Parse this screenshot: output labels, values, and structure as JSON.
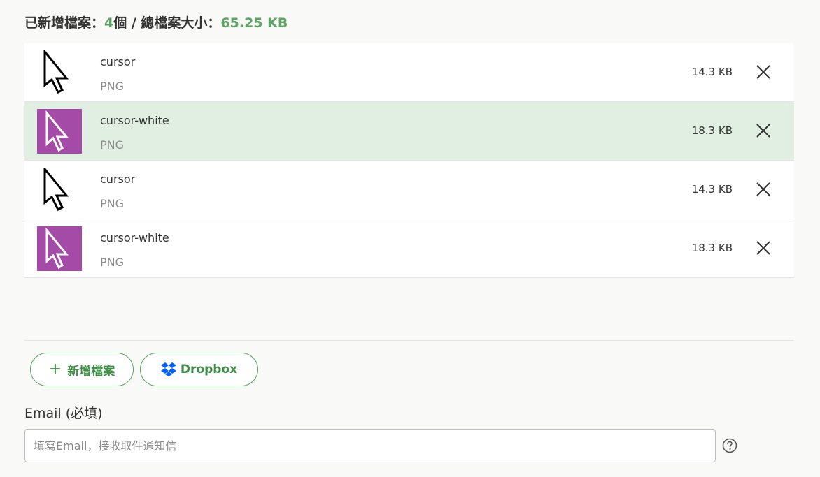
{
  "summary": {
    "added_label": "已新增檔案：",
    "file_count": "4",
    "count_unit": "個 / 總檔案大小：",
    "total_size": "65.25 KB"
  },
  "files": [
    {
      "name": "cursor",
      "type": "PNG",
      "size": "14.3 KB",
      "thumb": "cursor-black-icon",
      "highlighted": false
    },
    {
      "name": "cursor-white",
      "type": "PNG",
      "size": "18.3 KB",
      "thumb": "cursor-white-icon",
      "highlighted": true
    },
    {
      "name": "cursor",
      "type": "PNG",
      "size": "14.3 KB",
      "thumb": "cursor-black-icon",
      "highlighted": false
    },
    {
      "name": "cursor-white",
      "type": "PNG",
      "size": "18.3 KB",
      "thumb": "cursor-white-icon",
      "highlighted": false
    }
  ],
  "buttons": {
    "add_files": "新增檔案",
    "dropbox": "Dropbox"
  },
  "email": {
    "label": "Email (必填)",
    "placeholder": "填寫Email，接收取件通知信",
    "value": ""
  },
  "colors": {
    "accent": "#5ba463",
    "highlight_row": "#e1eee2",
    "thumb_purple": "#a34ba6",
    "dropbox_blue": "#0061fe"
  }
}
